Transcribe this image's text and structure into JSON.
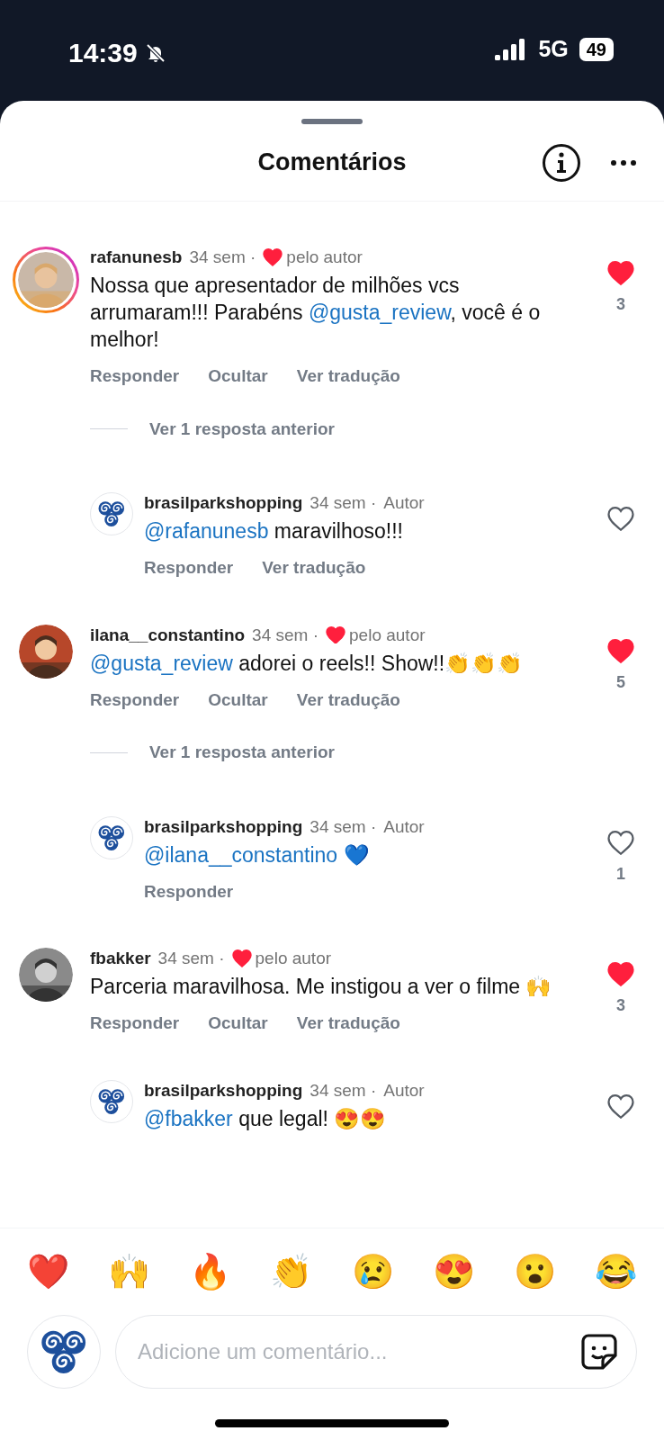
{
  "status_bar": {
    "time": "14:39",
    "network": "5G",
    "battery": "49",
    "silenced": true
  },
  "header": {
    "title": "Comentários"
  },
  "comments": [
    {
      "username": "rafanunesb",
      "time": "34 sem",
      "separator": "·",
      "author_liked": true,
      "author_like_label": "pelo autor",
      "story": true,
      "liked": true,
      "likes": "3",
      "text": [
        {
          "kind": "text",
          "text": "Nossa que apresentador de milhões vcs arrumaram!!! Parabéns "
        },
        {
          "kind": "mention",
          "text": "@gusta_review"
        },
        {
          "kind": "text",
          "text": ", você é o melhor!"
        }
      ],
      "actions": [
        "Responder",
        "Ocultar",
        "Ver tradução"
      ],
      "view_replies": "Ver 1 resposta anterior",
      "replies": [
        {
          "username": "brasilparkshopping",
          "time": "34 sem",
          "separator": "·",
          "badge": "Autor",
          "liked": false,
          "text": [
            {
              "kind": "mention",
              "text": "@rafanunesb"
            },
            {
              "kind": "text",
              "text": " maravilhoso!!!"
            }
          ],
          "actions": [
            "Responder",
            "Ver tradução"
          ]
        }
      ]
    },
    {
      "username": "ilana__constantino",
      "time": "34 sem",
      "separator": "·",
      "author_liked": true,
      "author_like_label": "pelo autor",
      "story": false,
      "liked": true,
      "likes": "5",
      "text": [
        {
          "kind": "mention",
          "text": "@gusta_review"
        },
        {
          "kind": "text",
          "text": " adorei o reels!! Show!!👏👏👏"
        }
      ],
      "actions": [
        "Responder",
        "Ocultar",
        "Ver tradução"
      ],
      "view_replies": "Ver 1 resposta anterior",
      "replies": [
        {
          "username": "brasilparkshopping",
          "time": "34 sem",
          "separator": "·",
          "badge": "Autor",
          "liked": false,
          "likes": "1",
          "text": [
            {
              "kind": "mention",
              "text": "@ilana__constantino"
            },
            {
              "kind": "text",
              "text": " 💙"
            }
          ],
          "actions": [
            "Responder"
          ]
        }
      ]
    },
    {
      "username": "fbakker",
      "time": "34 sem",
      "separator": "·",
      "author_liked": true,
      "author_like_label": "pelo autor",
      "story": false,
      "liked": true,
      "likes": "3",
      "text": [
        {
          "kind": "text",
          "text": "Parceria maravilhosa. Me instigou a ver o filme 🙌"
        }
      ],
      "actions": [
        "Responder",
        "Ocultar",
        "Ver tradução"
      ],
      "replies": [
        {
          "username": "brasilparkshopping",
          "time": "34 sem",
          "separator": "·",
          "badge": "Autor",
          "liked": false,
          "text": [
            {
              "kind": "mention",
              "text": "@fbakker"
            },
            {
              "kind": "text",
              "text": " que legal! 😍😍"
            }
          ]
        }
      ]
    }
  ],
  "reactions": [
    "❤️",
    "🙌",
    "🔥",
    "👏",
    "😢",
    "😍",
    "😮",
    "😂"
  ],
  "composer": {
    "placeholder": "Adicione um comentário..."
  }
}
